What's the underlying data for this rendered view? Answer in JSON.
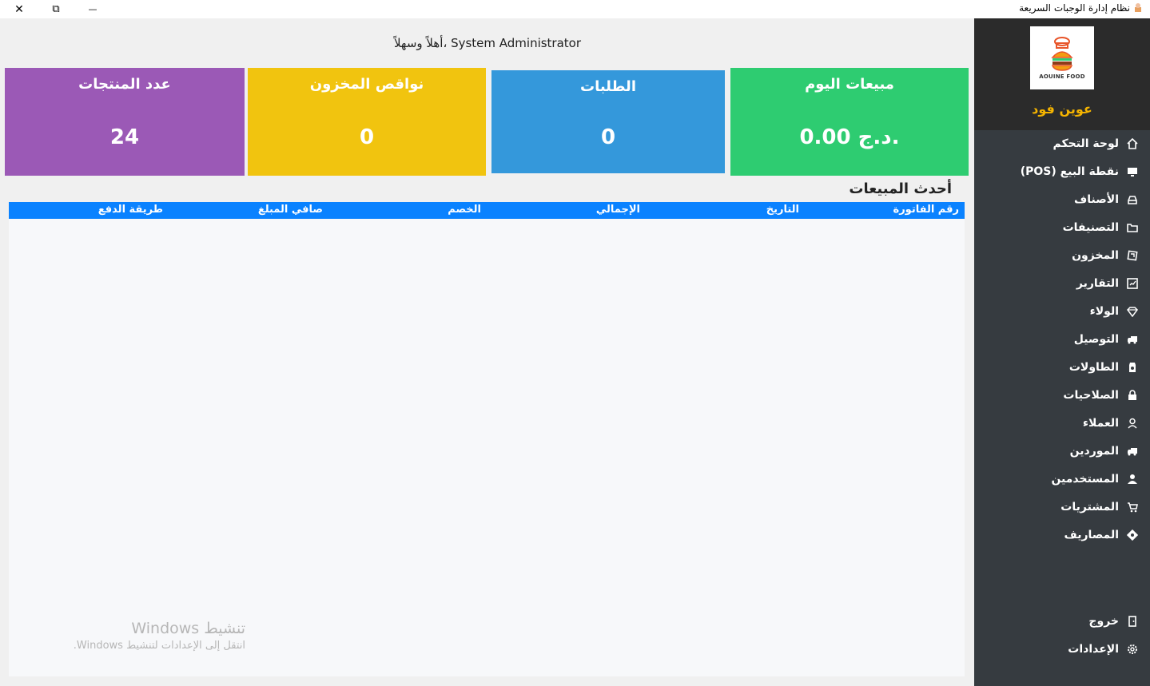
{
  "window": {
    "title": "نظام إدارة الوجبات السريعة",
    "close_glyph": "✕",
    "restore_glyph": "⧉",
    "minimize_glyph": "—"
  },
  "header": {
    "welcome": "أهلاً وسهلاً، System Administrator"
  },
  "cards": [
    {
      "title": "عدد المنتجات",
      "value": "24",
      "color": "#9b59b6"
    },
    {
      "title": "نواقص المخزون",
      "value": "0",
      "color": "#f1c40f"
    },
    {
      "title": "الطلبات",
      "value": "0",
      "color": "#3498db"
    },
    {
      "title": "مبيعات اليوم",
      "value": "0.00 د.ج.",
      "color": "#2ecc71"
    }
  ],
  "recent_sales": {
    "title": "أحدث المبيعات",
    "columns": [
      "رقم الفاتورة",
      "التاريخ",
      "الإجمالي",
      "الخصم",
      "صافي المبلغ",
      "طريقة الدفع"
    ],
    "rows": []
  },
  "watermark": {
    "line1": "تنشيط Windows",
    "line2": "انتقل إلى الإعدادات لتنشيط Windows."
  },
  "sidebar": {
    "logo_text": "AOUINE FOOD",
    "brand": "عوين فود",
    "items": [
      {
        "label": "لوحة التحكم",
        "icon": "home-icon"
      },
      {
        "label": "نقطة البيع (POS)",
        "icon": "monitor-icon"
      },
      {
        "label": "الأصناف",
        "icon": "box-icon"
      },
      {
        "label": "التصنيفات",
        "icon": "folder-icon"
      },
      {
        "label": "المخزون",
        "icon": "warehouse-icon"
      },
      {
        "label": "التقارير",
        "icon": "report-icon"
      },
      {
        "label": "الولاء",
        "icon": "diamond-icon"
      },
      {
        "label": "التوصيل",
        "icon": "truck-icon"
      },
      {
        "label": "الطاولات",
        "icon": "table-icon"
      },
      {
        "label": "الصلاحيات",
        "icon": "lock-icon"
      },
      {
        "label": "العملاء",
        "icon": "user-icon"
      },
      {
        "label": "الموردين",
        "icon": "supplier-truck-icon"
      },
      {
        "label": "المستخدمين",
        "icon": "users-icon"
      },
      {
        "label": "المشتريات",
        "icon": "cart-icon"
      },
      {
        "label": "المصاريف",
        "icon": "money-icon"
      }
    ],
    "bottom": [
      {
        "label": "خروج",
        "icon": "exit-icon"
      },
      {
        "label": "الإعدادات",
        "icon": "gear-icon"
      }
    ]
  }
}
